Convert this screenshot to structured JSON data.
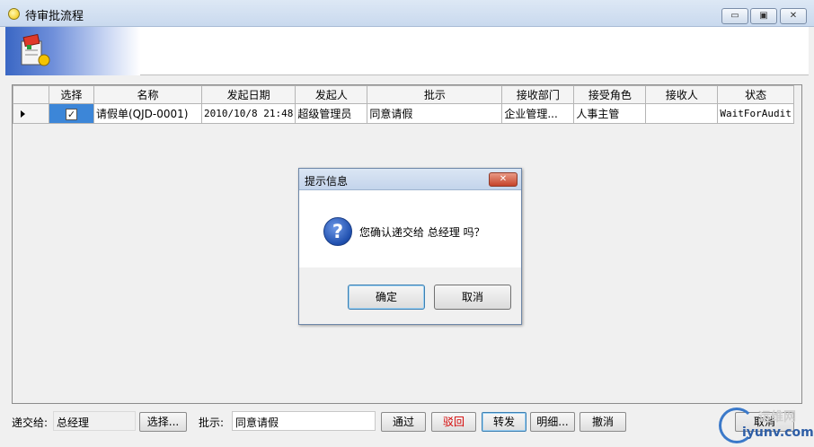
{
  "window": {
    "title": "待审批流程",
    "minimize_label": "▭",
    "maximize_label": "▣",
    "close_label": "✕"
  },
  "grid": {
    "columns": [
      "选择",
      "名称",
      "发起日期",
      "发起人",
      "批示",
      "接收部门",
      "接受角色",
      "接收人",
      "状态"
    ],
    "rows": [
      {
        "selected": "✓",
        "name": "请假单(QJD-0001)",
        "date": "2010/10/8 21:48",
        "initiator": "超级管理员",
        "instruction": "同意请假",
        "dept": "企业管理...",
        "role": "人事主管",
        "receiver": "",
        "status": "WaitForAudit"
      }
    ]
  },
  "dialog": {
    "title": "提示信息",
    "message": "您确认递交给 总经理 吗？",
    "close_label": "✕",
    "ok_label": "确定",
    "cancel_label": "取消"
  },
  "bottom": {
    "submit_to_label": "递交给:",
    "submit_to_value": "总经理",
    "select_label": "选择...",
    "instruction_label": "批示:",
    "instruction_value": "同意请假",
    "pass_label": "通过",
    "reject_label": "驳回",
    "forward_label": "转发",
    "detail_label": "明细...",
    "revoke_label": "撤消",
    "cancel_label": "取消"
  },
  "watermark": {
    "cn": "运维网",
    "en": "iyunv.com"
  },
  "colors": {
    "selection_blue": "#3c86d8",
    "reject_red": "#d40000"
  }
}
